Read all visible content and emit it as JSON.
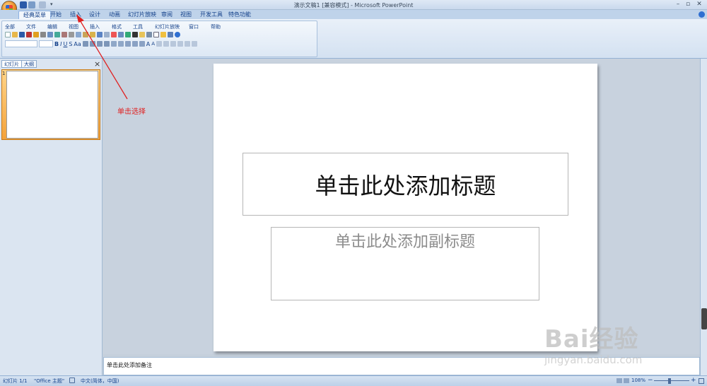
{
  "window": {
    "title": "演示文稿1 [兼容模式] - Microsoft PowerPoint"
  },
  "tabs": [
    {
      "label": "经典菜单"
    },
    {
      "label": "开始"
    },
    {
      "label": "插入"
    },
    {
      "label": "设计"
    },
    {
      "label": "动画"
    },
    {
      "label": "幻灯片放映"
    },
    {
      "label": "审阅"
    },
    {
      "label": "视图"
    },
    {
      "label": "开发工具"
    },
    {
      "label": "特色功能"
    }
  ],
  "menubar": [
    {
      "label": "全部"
    },
    {
      "label": "文件"
    },
    {
      "label": "编辑"
    },
    {
      "label": "视图"
    },
    {
      "label": "插入"
    },
    {
      "label": "格式"
    },
    {
      "label": "工具"
    },
    {
      "label": "幻灯片放映"
    },
    {
      "label": "窗口"
    },
    {
      "label": "帮助"
    }
  ],
  "left_pane": {
    "tabs": [
      {
        "label": "幻灯片"
      },
      {
        "label": "大纲"
      }
    ],
    "close": "×",
    "slide_number": "1"
  },
  "slide": {
    "title_placeholder": "单击此处添加标题",
    "subtitle_placeholder": "单击此处添加副标题"
  },
  "notes": {
    "placeholder": "单击此处添加备注"
  },
  "annotation": {
    "text": "单击选择",
    "color": "#e02020"
  },
  "status": {
    "slide_info": "幻灯片 1/1",
    "theme": "\"Office 主题\"",
    "language": "中文(简体，中国)",
    "zoom": "108%"
  },
  "watermark": {
    "brand": "Bai经验",
    "url": "jingyan.baidu.com"
  },
  "colors": {
    "ribbon": "#dbe5f1",
    "tab_active": "#f3f7fc",
    "accent": "#15428b",
    "thumb_selected": "#f3a23a"
  }
}
